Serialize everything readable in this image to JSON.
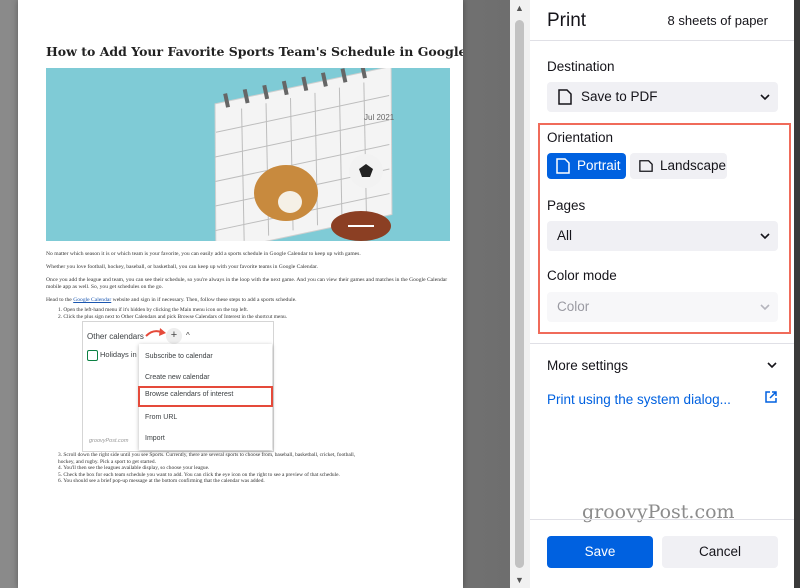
{
  "document": {
    "title": "How to Add Your Favorite Sports Team's Schedule in Google Calendar",
    "calendar_label": "Jul 2021",
    "paragraphs": [
      "No matter which season it is or which team is your favorite, you can easily add a sports schedule in Google Calendar to keep up with games.",
      "Whether you love football, hockey, baseball, or basketball, you can keep up with your favorite teams in Google Calendar.",
      "Once you add the league and team, you can see their schedule, so you're always in the loop with the next game. And you can view their games and matches in the Google Calendar mobile app as well. So, you get schedules on the go."
    ],
    "head_para": {
      "before": "Head to the ",
      "link": "Google Calendar",
      "after": " website and sign in if necessary. Then, follow these steps to add a sports schedule."
    },
    "steps_top": [
      "1. Open the left-hand menu if it's hidden by clicking the Main menu icon on the top left.",
      "2. Click the plus sign next to Other Calendars and pick Browse Calendars of Interest in the shortcut menu."
    ],
    "steps_bottom": [
      "3. Scroll down the right side until you see Sports. Currently, there are several sports to choose from, baseball, basketball, cricket, football,",
      "    hockey, and rugby. Pick a sport to get started.",
      "4. You'll then see the leagues available display, so choose your league.",
      "5. Check the box for each team schedule you want to add. You can click the eye icon on the right to see a preview of that schedule.",
      "6. You should see a brief pop-up message at the bottom confirming that the calendar was added."
    ],
    "embedded": {
      "other_calendars": "Other calendars",
      "holidays": "Holidays in",
      "menu": [
        "Subscribe to calendar",
        "Create new calendar",
        "Browse calendars of interest",
        "From URL",
        "Import"
      ],
      "watermark": "groovyPost.com"
    }
  },
  "print": {
    "title": "Print",
    "sheets": "8 sheets of paper",
    "destination_label": "Destination",
    "destination_value": "Save to PDF",
    "orientation_label": "Orientation",
    "portrait": "Portrait",
    "landscape": "Landscape",
    "orientation_selected": "Portrait",
    "pages_label": "Pages",
    "pages_value": "All",
    "color_label": "Color mode",
    "color_value": "Color",
    "more_settings": "More settings",
    "system_dialog": "Print using the system dialog...",
    "save": "Save",
    "cancel": "Cancel",
    "watermark": "groovyPost.com"
  },
  "colors": {
    "accent": "#0061e0",
    "highlight_box": "#f06b5a"
  }
}
